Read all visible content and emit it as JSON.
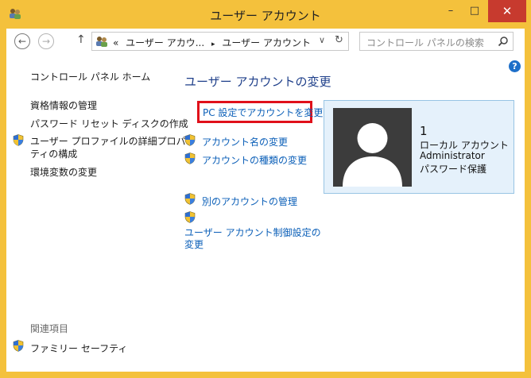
{
  "window": {
    "title": "ユーザー アカウント",
    "controls": {
      "minimize": "–",
      "maximize": "□",
      "close": "✕"
    }
  },
  "toolbar": {
    "address_prefix": "«",
    "address_crumb1": "ユーザー アカウ...",
    "address_sep": "▸",
    "address_crumb2": "ユーザー アカウント",
    "search_placeholder": "コントロール パネルの検索",
    "help": "?"
  },
  "sidebar": {
    "home": "コントロール パネル ホーム",
    "items": [
      "資格情報の管理",
      "パスワード リセット ディスクの作成",
      "ユーザー プロファイルの詳細プロパ",
      "ティの構成",
      "環境変数の変更"
    ],
    "related_heading": "関連項目",
    "related_item": "ファミリー セーフティ"
  },
  "main": {
    "title": "ユーザー アカウントの変更",
    "pc_settings_link": "PC 設定でアカウントを変更",
    "change_name": "アカウント名の変更",
    "change_type": "アカウントの種類の変更",
    "manage_other": "別のアカウントの管理",
    "uac_line1": "ユーザー アカウント制御設定の",
    "uac_line2": "変更"
  },
  "account": {
    "name": "1",
    "type": "ローカル アカウント",
    "role": "Administrator",
    "password": "パスワード保護"
  }
}
